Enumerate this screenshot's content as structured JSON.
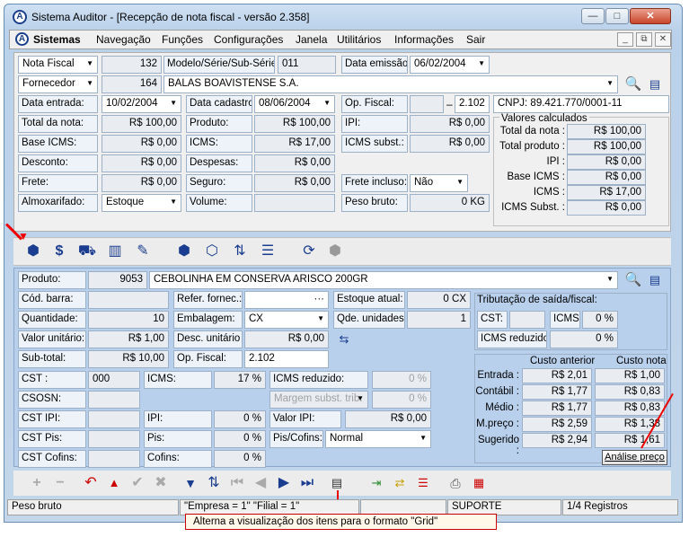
{
  "window": {
    "title": "Sistema Auditor - [Recepção de nota fiscal - versão 2.358]",
    "app_icon_letter": "A",
    "btn_min": "—",
    "btn_max": "□",
    "btn_close": "✕"
  },
  "menubar": {
    "items": [
      "Sistemas",
      "Navegação",
      "Funções",
      "Configurações",
      "Janela",
      "Utilitários",
      "Informações",
      "Sair"
    ],
    "btn_min": "_",
    "btn_restore": "⧉",
    "btn_close": "✕"
  },
  "header": {
    "doc_type": "Nota Fiscal",
    "doc_number": "132",
    "model_label": "Modelo/Série/Sub-Série:",
    "model_value": "011",
    "emission_label": "Data emissão:",
    "emission_value": "06/02/2004",
    "supplier_type": "Fornecedor",
    "supplier_code": "164",
    "supplier_name": "BALAS BOAVISTENSE S.A.",
    "entry_label": "Data entrada:",
    "entry_value": "10/02/2004",
    "reg_label": "Data cadastro:",
    "reg_value": "08/06/2004",
    "op_label": "Op. Fiscal:",
    "op_value": "2.102",
    "op_dash": "–",
    "cnpj": "CNPJ: 89.421.770/0001-11",
    "total_label": "Total da nota:",
    "total_value": "R$ 100,00",
    "produto_label": "Produto:",
    "produto_value": "R$ 100,00",
    "ipi_label": "IPI:",
    "ipi_value": "R$ 0,00",
    "base_label": "Base ICMS:",
    "base_value": "R$ 0,00",
    "icms_label": "ICMS:",
    "icms_value": "R$ 17,00",
    "icmss_label": "ICMS subst.:",
    "icmss_value": "R$ 0,00",
    "desc_label": "Desconto:",
    "desc_value": "R$ 0,00",
    "desp_label": "Despesas:",
    "desp_value": "R$ 0,00",
    "frete_label": "Frete:",
    "frete_value": "R$ 0,00",
    "seg_label": "Seguro:",
    "seg_value": "R$ 0,00",
    "fretei_label": "Frete incluso:",
    "fretei_value": "Não",
    "alm_label": "Almoxarifado:",
    "alm_value": "Estoque",
    "vol_label": "Volume:",
    "peso_label": "Peso bruto:",
    "peso_value": "0 KG"
  },
  "calc": {
    "title": "Valores calculados",
    "rows": [
      {
        "label": "Total da nota :",
        "value": "R$ 100,00"
      },
      {
        "label": "Total produto :",
        "value": "R$ 100,00"
      },
      {
        "label": "IPI :",
        "value": "R$ 0,00"
      },
      {
        "label": "Base ICMS :",
        "value": "R$ 0,00"
      },
      {
        "label": "ICMS :",
        "value": "R$ 17,00"
      },
      {
        "label": "ICMS Subst. :",
        "value": "R$ 0,00"
      }
    ]
  },
  "item": {
    "produto_label": "Produto:",
    "produto_code": "9053",
    "produto_name": "CEBOLINHA EM CONSERVA ARISCO          200GR",
    "cod_label": "Cód. barra:",
    "ref_label": "Refer. fornec.:",
    "ref_btn": "···",
    "estoque_label": "Estoque atual:",
    "estoque_value": "0 CX",
    "qtd_label": "Quantidade:",
    "qtd_value": "10",
    "emb_label": "Embalagem:",
    "emb_value": "CX",
    "qde_label": "Qde. unidades:",
    "qde_value": "1",
    "vu_label": "Valor unitário:",
    "vu_value": "R$ 1,00",
    "du_label": "Desc. unitário :",
    "du_value": "R$ 0,00",
    "sub_label": "Sub-total:",
    "sub_value": "R$ 10,00",
    "op_label": "Op. Fiscal:",
    "op_value": "2.102",
    "cst_label": "CST :",
    "cst_value": "000",
    "icms_label": "ICMS:",
    "icms_value": "17 %",
    "icmsr_label": "ICMS reduzido:",
    "icmsr_value": "0 %",
    "csosn_label": "CSOSN:",
    "margem_label": "Margem subst. trib.",
    "margem_value": "0 %",
    "cstipi_label": "CST  IPI:",
    "ipi_label": "IPI:",
    "ipi_value": "0 %",
    "vipi_label": "Valor IPI:",
    "vipi_value": "R$ 0,00",
    "cstpis_label": "CST  Pis:",
    "pis_label": "Pis:",
    "pis_value": "0 %",
    "piscof_label": "Pis/Cofins:",
    "piscof_value": "Normal",
    "cstcof_label": "CST Cofins:",
    "cof_label": "Cofins:",
    "cof_value": "0 %"
  },
  "trib": {
    "title": "Tributação de saída/fiscal:",
    "cst_label": "CST:",
    "icms_label": "ICMS:",
    "icms_value": "0 %",
    "red_label": "ICMS reduzido:",
    "red_value": "0 %"
  },
  "custo": {
    "head_ant": "Custo anterior",
    "head_nota": "Custo nota",
    "rows": [
      {
        "label": "Entrada :",
        "ant": "R$ 2,01",
        "nota": "R$ 1,00"
      },
      {
        "label": "Contábil :",
        "ant": "R$ 1,77",
        "nota": "R$ 0,83"
      },
      {
        "label": "Médio :",
        "ant": "R$ 1,77",
        "nota": "R$ 0,83"
      },
      {
        "label": "M.preço :",
        "ant": "R$ 2,59",
        "nota": "R$ 1,38"
      },
      {
        "label": "Sugerido :",
        "ant": "R$ 2,94",
        "nota": "R$ 1,61"
      }
    ],
    "analise_btn": "Análise preço"
  },
  "status": {
    "left": "Peso bruto",
    "empresa": "\"Empresa = 1\"  \"Filial = 1\"",
    "user": "SUPORTE",
    "records": "1/4 Registros"
  },
  "tooltip": "Alterna a visualização dos itens para o formato \"Grid\"",
  "colors": {
    "accent_red": "#e00000",
    "panel_blue": "#b8d0ec"
  }
}
